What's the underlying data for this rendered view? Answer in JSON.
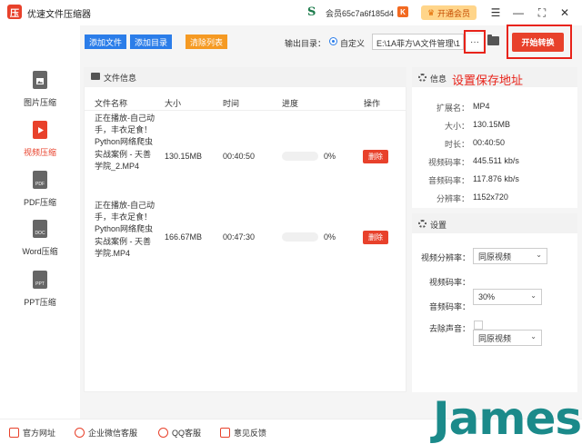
{
  "app": {
    "logo": "压",
    "title": "优速文件压缩器",
    "member_icon": "S",
    "member_id": "会员65c7a6f185d4",
    "vip_badge": "K",
    "open_vip": "开通会员"
  },
  "window_controls": {
    "menu": "☰",
    "minimize": "—",
    "maximize": "⛶",
    "close": "✕"
  },
  "sidebar": {
    "items": [
      {
        "label": "图片压缩",
        "icon": "image-file-icon",
        "active": false
      },
      {
        "label": "视频压缩",
        "icon": "video-file-icon",
        "active": true
      },
      {
        "label": "PDF压缩",
        "icon": "pdf-file-icon",
        "active": false,
        "tag": "PDF"
      },
      {
        "label": "Word压缩",
        "icon": "word-file-icon",
        "active": false,
        "tag": "DOC"
      },
      {
        "label": "PPT压缩",
        "icon": "ppt-file-icon",
        "active": false,
        "tag": "PPT"
      }
    ]
  },
  "toolbar": {
    "add_file": "添加文件",
    "add_dir": "添加目录",
    "clear_list": "清除列表",
    "output_dir_label": "输出目录：",
    "radio_custom": "自定义",
    "path_value": "E:\\1A菲方\\A文件管理\\1",
    "more": "···",
    "start": "开始转换"
  },
  "file_panel": {
    "title": "文件信息",
    "columns": [
      "文件名称",
      "大小",
      "时间",
      "进度",
      "操作"
    ],
    "rows": [
      {
        "name": "正在播放-自己动手，丰衣足食！Python网络爬虫实战案例 - 天善学院_2.MP4",
        "size": "130.15MB",
        "time": "00:40:50",
        "progress": "0%",
        "progress_value": 0,
        "action": "删除"
      },
      {
        "name": "正在播放-自己动手，丰衣足食！Python网络爬虫实战案例 - 天善学院.MP4",
        "size": "166.67MB",
        "time": "00:47:30",
        "progress": "0%",
        "progress_value": 0,
        "action": "删除"
      }
    ]
  },
  "info_panel": {
    "title": "信息",
    "annotation": "设置保存地址",
    "fields": [
      {
        "label": "扩展名：",
        "value": "MP4"
      },
      {
        "label": "大小：",
        "value": "130.15MB"
      },
      {
        "label": "时长：",
        "value": "00:40:50"
      },
      {
        "label": "视频码率：",
        "value": "445.511 kb/s"
      },
      {
        "label": "音频码率：",
        "value": "117.876 kb/s"
      },
      {
        "label": "分辨率：",
        "value": "1152x720"
      }
    ]
  },
  "settings_panel": {
    "title": "设置",
    "video_res_label": "视频分辨率：",
    "video_res_value": "同原视频",
    "video_bitrate_label": "视频码率：",
    "video_bitrate_value": "30%",
    "audio_bitrate_label": "音频码率：",
    "audio_bitrate_value": "同原视频",
    "remove_audio_label": "去除声音：",
    "remove_audio_checked": false
  },
  "footer": {
    "website": "官方网址",
    "wechat": "企业微信客服",
    "qq": "QQ客服",
    "feedback": "意见反馈"
  },
  "watermark": {
    "text": "James"
  },
  "colors": {
    "accent": "#e8412b",
    "blue": "#2b7de9",
    "orange": "#f59a23",
    "annotation_red": "#e8231a"
  }
}
